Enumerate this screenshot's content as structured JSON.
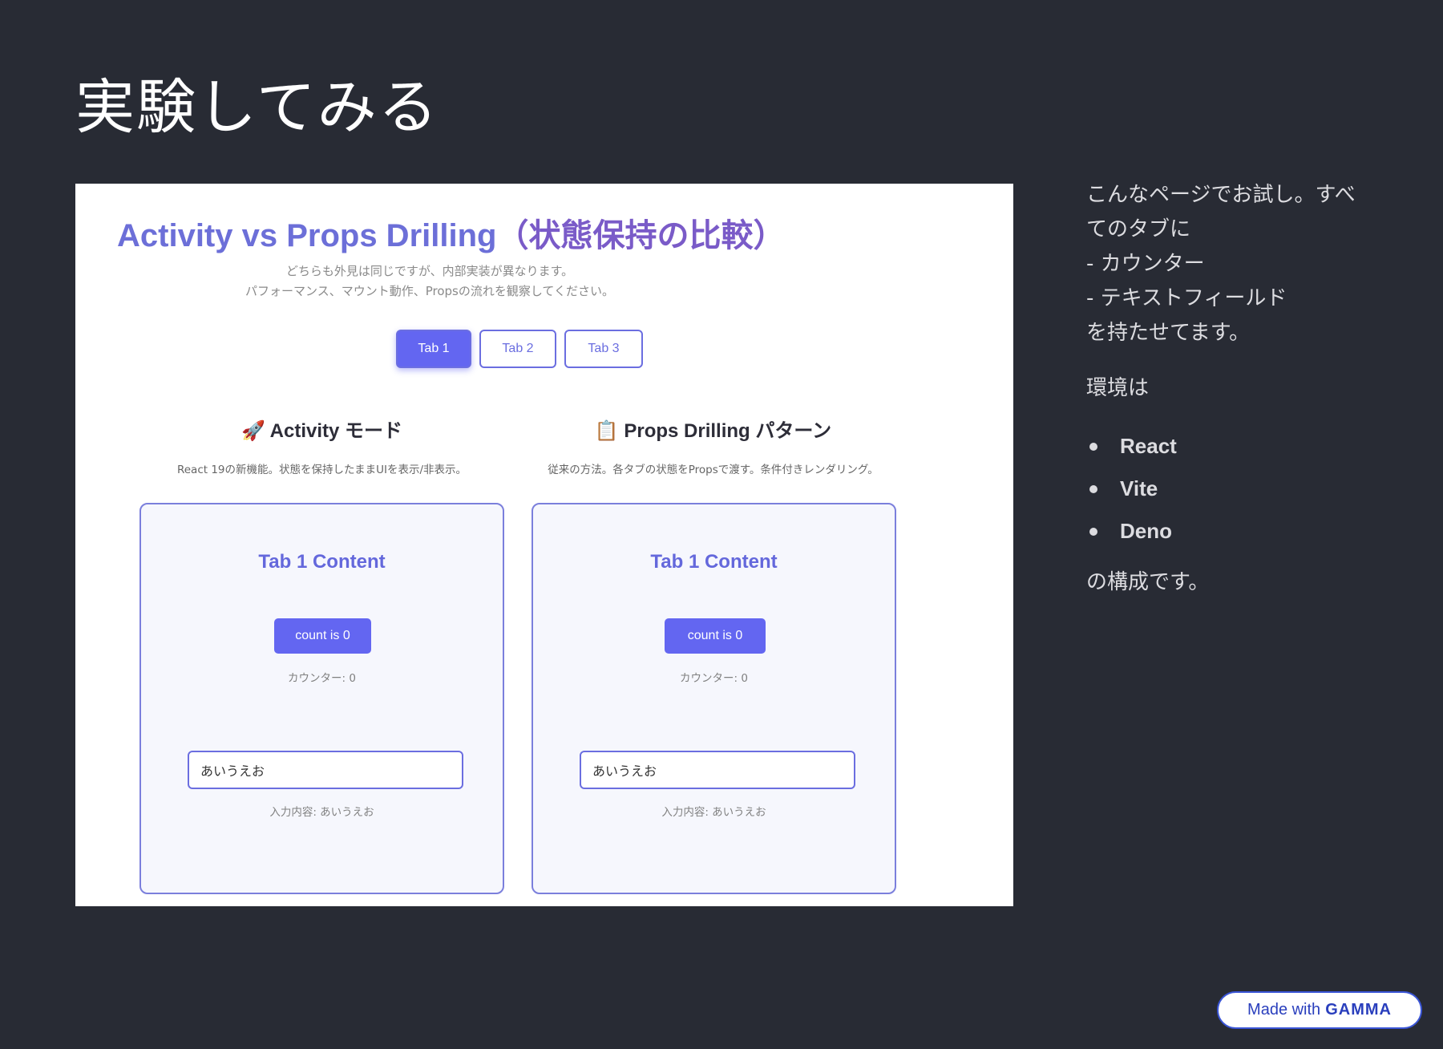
{
  "slide": {
    "title": "実験してみる"
  },
  "demo": {
    "title_en": "Activity vs Props Drilling",
    "title_ja": "（状態保持の比較）",
    "subtitle_line1": "どちらも外見は同じですが、内部実装が異なります。",
    "subtitle_line2": "パフォーマンス、マウント動作、Propsの流れを観察してください。",
    "tabs": [
      {
        "label": "Tab 1",
        "active": true
      },
      {
        "label": "Tab 2",
        "active": false
      },
      {
        "label": "Tab 3",
        "active": false
      }
    ],
    "sections": [
      {
        "icon": "🚀",
        "heading": "Activity モード",
        "description": "React 19の新機能。状態を保持したままUIを表示/非表示。",
        "panel_title": "Tab 1 Content",
        "count_button": "count is 0",
        "counter_label": "カウンター: 0",
        "input_value": "あいうえお",
        "input_label": "入力内容: あいうえお"
      },
      {
        "icon": "📋",
        "heading": "Props Drilling パターン",
        "description": "従来の方法。各タブの状態をPropsで渡す。条件付きレンダリング。",
        "panel_title": "Tab 1 Content",
        "count_button": "count is 0",
        "counter_label": "カウンター: 0",
        "input_value": "あいうえお",
        "input_label": "入力内容: あいうえお"
      }
    ]
  },
  "side": {
    "intro": "こんなページでお試し。すべ\nてのタブに\n- カウンター\n- テキストフィールド\nを持たせてます。",
    "env_label": "環境は",
    "env_items": [
      "React",
      "Vite",
      "Deno"
    ],
    "tail": "の構成です。"
  },
  "badge": {
    "prefix": "Made with",
    "brand": "GAMMA"
  },
  "colors": {
    "background": "#282b34",
    "accent": "#6366f1",
    "title_gradient_start": "#6c6fd8",
    "title_gradient_end": "#7a5bc8"
  }
}
